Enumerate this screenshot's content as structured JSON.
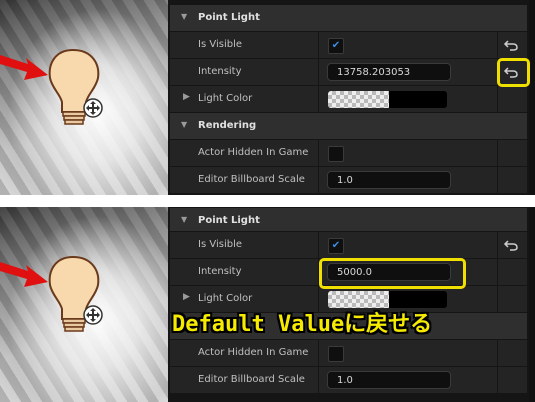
{
  "top": {
    "category_point_light": "Point Light",
    "is_visible_label": "Is Visible",
    "is_visible_checked": true,
    "intensity_label": "Intensity",
    "intensity_value": "13758.203053",
    "light_color_label": "Light Color",
    "category_rendering": "Rendering",
    "actor_hidden_label": "Actor Hidden In Game",
    "actor_hidden_checked": false,
    "billboard_scale_label": "Editor Billboard Scale",
    "billboard_scale_value": "1.0"
  },
  "bottom": {
    "category_point_light": "Point Light",
    "is_visible_label": "Is Visible",
    "is_visible_checked": true,
    "intensity_label": "Intensity",
    "intensity_value": "5000.0",
    "light_color_label": "Light Color",
    "actor_hidden_label": "Actor Hidden In Game",
    "actor_hidden_checked": false,
    "billboard_scale_label": "Editor Billboard Scale",
    "billboard_scale_value": "1.0"
  },
  "caption": "Default Valueに戻せる",
  "colors": {
    "panel_bg": "#151515",
    "row_bg": "#242424",
    "category_bg": "#2f2f2f",
    "highlight": "#f0e000",
    "arrow": "#e01010",
    "checkbox_check": "#3a8ee6",
    "bulb": "#f7d9ad"
  },
  "icons": [
    "red-arrow-icon",
    "light-bulb-icon",
    "move-gizmo-icon",
    "reset-to-default-icon",
    "checkmark-icon",
    "caret-down-icon",
    "caret-right-icon"
  ]
}
